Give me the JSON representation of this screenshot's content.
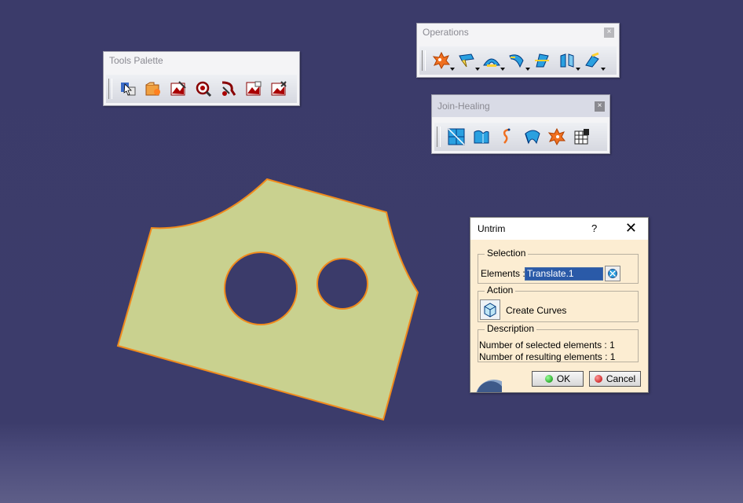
{
  "tools_palette": {
    "title": "Tools Palette",
    "icons": [
      "select-icon",
      "folder-add-icon",
      "image-remove-icon",
      "magnifier-icon",
      "scissors-link-icon",
      "image-export-icon",
      "image-import-icon"
    ]
  },
  "operations": {
    "title": "Operations",
    "close": "×",
    "icons": [
      "join-icon",
      "healing-icon",
      "untrim-icon",
      "disassemble-icon",
      "split-icon",
      "trim-icon",
      "boundary-icon"
    ]
  },
  "join_healing": {
    "title": "Join-Healing",
    "close": "×",
    "icons": [
      "join-patch-icon",
      "surface-heal-icon",
      "curve-smooth-icon",
      "untrim-surface-icon",
      "disassemble-icon",
      "grid-icon"
    ]
  },
  "dialog": {
    "title": "Untrim",
    "help": "?",
    "close": "✕",
    "selection_label": "Selection",
    "elements_label": "Elements :",
    "elements_value": "Translate.1",
    "action_label": "Action",
    "action_text": "Create Curves",
    "description_label": "Description",
    "desc_line1": "Number of selected elements : 1",
    "desc_line2": "Number of resulting elements : 1",
    "ok_label": "OK",
    "cancel_label": "Cancel"
  },
  "colors": {
    "background": "#3b3b6a",
    "surface_fill": "#c9d18f",
    "surface_edge": "#f08a1c",
    "dialog_bg": "#fcedd2",
    "selected_field": "#2a5aa8"
  }
}
